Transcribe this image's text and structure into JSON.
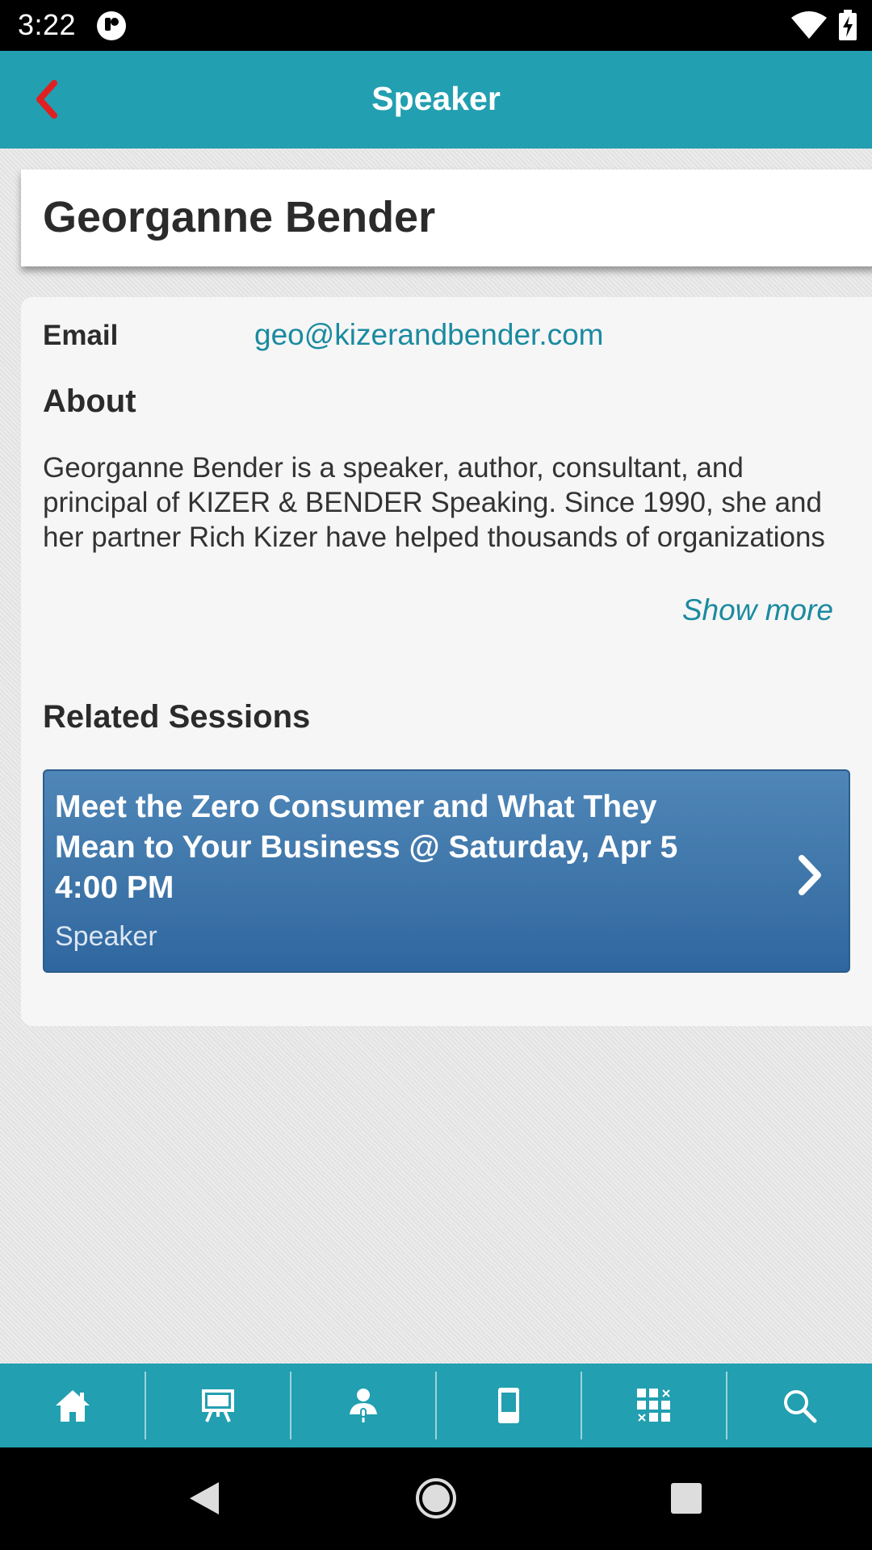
{
  "status_bar": {
    "time": "3:22",
    "app_icon": "pocket-app-icon",
    "wifi_icon": "wifi-icon",
    "battery_icon": "battery-charging-icon"
  },
  "app_bar": {
    "title": "Speaker",
    "back_icon": "chevron-left-icon",
    "back_color": "#e02020",
    "background": "#229fb0"
  },
  "speaker": {
    "name": "Georganne Bender",
    "email_label": "Email",
    "email": "geo@kizerandbender.com",
    "about_heading": "About",
    "about_text": "Georganne Bender is a speaker, author, consultant, and principal of KIZER & BENDER Speaking. Since 1990, she and her partner Rich Kizer have helped thousands of organizations across diverse sales and service industries",
    "show_more": "Show more"
  },
  "related": {
    "heading": "Related Sessions",
    "sessions": [
      {
        "title": "Meet the Zero Consumer and What They Mean to Your Business @ Saturday, Apr 5 4:00 PM",
        "role": "Speaker"
      }
    ]
  },
  "bottom_nav": {
    "items": [
      {
        "icon": "home-icon"
      },
      {
        "icon": "presentation-board-icon"
      },
      {
        "icon": "speaker-person-icon"
      },
      {
        "icon": "mobile-device-icon"
      },
      {
        "icon": "grid-apps-icon"
      },
      {
        "icon": "search-icon"
      }
    ]
  },
  "system_nav": {
    "back_icon": "triangle-back-icon",
    "home_icon": "circle-home-icon",
    "recents_icon": "square-recents-icon"
  }
}
